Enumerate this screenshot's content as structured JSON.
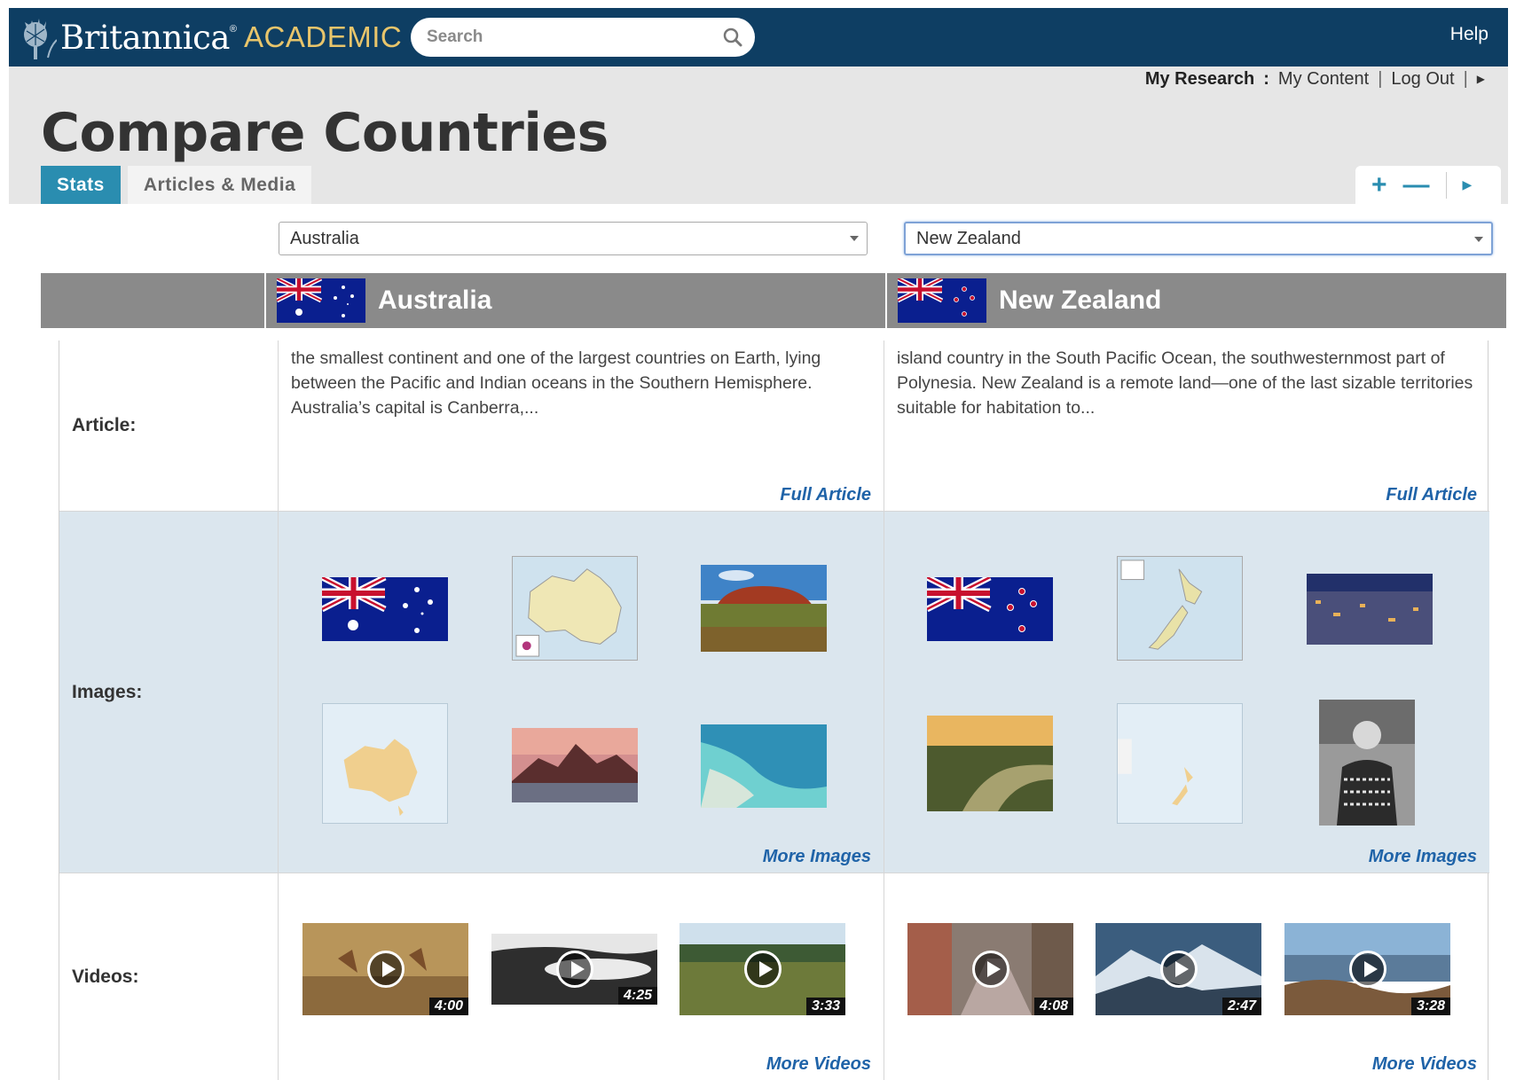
{
  "topbar": {
    "brand": "Britannica",
    "brand_sub": "ACADEMIC",
    "search_placeholder": "Search",
    "help": "Help"
  },
  "account": {
    "my_research": "My Research",
    "colon": ":",
    "my_content": "My Content",
    "log_out": "Log Out",
    "sep": "|"
  },
  "page": {
    "title": "Compare Countries",
    "tabs": [
      {
        "label": "Stats",
        "active": true
      },
      {
        "label": "Articles & Media",
        "active": false
      }
    ]
  },
  "selectors": {
    "left": "Australia",
    "right": "New Zealand"
  },
  "countries": [
    {
      "name": "Australia",
      "article": "the smallest continent and one of the largest countries on Earth, lying between the Pacific and Indian oceans in the Southern Hemisphere. Australia’s capital is Canberra,...",
      "full_article": "Full Article",
      "more_images": "More Images",
      "more_videos": "More Videos",
      "videos": [
        "4:00",
        "4:25",
        "3:33"
      ]
    },
    {
      "name": "New Zealand",
      "article": "island country in the South Pacific Ocean, the southwesternmost part of Polynesia. New Zealand is a remote land—one of the last sizable territories suitable for habitation to...",
      "full_article": "Full Article",
      "more_images": "More Images",
      "more_videos": "More Videos",
      "videos": [
        "4:08",
        "2:47",
        "3:28"
      ]
    }
  ],
  "row_labels": {
    "article": "Article:",
    "images": "Images:",
    "videos": "Videos:"
  },
  "colors": {
    "topbar": "#0e3e63",
    "accent": "#2a8db0",
    "link": "#1f63a8",
    "band": "#8a8a8a",
    "images_row": "#dbe6ee"
  }
}
